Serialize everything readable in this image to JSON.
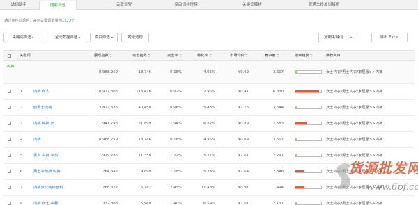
{
  "tabs": [
    {
      "label": "选词助手",
      "active": false
    },
    {
      "label": "搜索词查",
      "active": true
    },
    {
      "label": "关联词查",
      "active": false
    },
    {
      "label": "类目词排行榜",
      "active": false
    },
    {
      "label": "关键词解析",
      "active": false
    },
    {
      "label": "直通车投放词解析",
      "active": false
    }
  ],
  "hint": {
    "prefix": "通过条件过滤后，来到关键词数量为",
    "count": "1223",
    "suffix": "个"
  },
  "toolbar": {
    "keyword_filter": "关键词筛选",
    "all_data_filter": "全同数据筛选",
    "category_filter": "类目筛选",
    "region_view": "地域透视",
    "add_keyword": "复制关键词",
    "export": "导出 Excel"
  },
  "columns": [
    "关键词",
    "展现指数",
    "点击指数",
    "点击率",
    "转化率",
    "市场均价",
    "竞争度",
    "搜索趋势",
    "推荐类目"
  ],
  "first_row": {
    "label": "内裤",
    "impressions": "8,968,259",
    "clicks": "18,746",
    "ctr": "0.18%",
    "cvr": "4.95%",
    "price": "¥0.69",
    "competition": "3,617",
    "category": "女士内衣/男士内衣/家居服>>内裤",
    "trend": 0.08,
    "trend_color": "#9bcf78"
  },
  "rows": [
    {
      "num": "1",
      "keyword": "内裤 女人",
      "impressions": "10,927,306",
      "clicks": "118,426",
      "ctr": "0.92%",
      "cvr": "2.95%",
      "price": "¥0.47",
      "competition": "6,830",
      "category": "女士内衣/男士内衣/家居服>>内裤",
      "trend": 0.92,
      "trend_color": "#e05a3c"
    },
    {
      "num": "2",
      "keyword": "韵男士内裤",
      "impressions": "3,827,336",
      "clicks": "40,450",
      "ctr": "0.96%",
      "cvr": "5.48%",
      "price": "¥2.16",
      "competition": "3,644",
      "category": "女士内衣/男士内衣/家居服>>内裤",
      "trend": 0.06,
      "trend_color": "#9bcf78"
    },
    {
      "num": "3",
      "keyword": "内裤 纯棉 女",
      "impressions": "1,941,793",
      "clicks": "21,899",
      "ctr": "1.94%",
      "cvr": "6.82%",
      "price": "¥0.89",
      "competition": "2,583",
      "category": "女士内衣/男士内衣/家居服>>内裤",
      "trend": 0.42,
      "trend_color": "#e05a3c"
    },
    {
      "num": "4",
      "keyword": "内裤",
      "impressions": "8,968,259",
      "clicks": "18,746",
      "ctr": "0.18%",
      "cvr": "4.95%",
      "price": "¥0.69",
      "competition": "3,617",
      "category": "女士内衣/男士内衣/家居服>>内裤",
      "trend": 0.06,
      "trend_color": "#9bcf78"
    },
    {
      "num": "5",
      "keyword": "男人 内裤 平角",
      "impressions": "929,285",
      "clicks": "11,358",
      "ctr": "1.12%",
      "cvr": "5.77%",
      "price": "¥2.01",
      "competition": "2,291",
      "category": "女士内衣/男士内衣/家居服>>内裤",
      "trend": 0.06,
      "trend_color": "#9bcf78"
    },
    {
      "num": "6",
      "keyword": "男士平角裤 内裤",
      "impressions": "764,845",
      "clicks": "9,899",
      "ctr": "1.18%",
      "cvr": "5.78%",
      "price": "¥2.64",
      "competition": "2,848",
      "category": "女士内衣/男士内衣/家居服>>内裤",
      "trend": 0.35,
      "trend_color": "#e05a3c"
    },
    {
      "num": "7",
      "keyword": "内裤女式纯棉面料",
      "impressions": "266,822",
      "clicks": "6,782",
      "ctr": "2.45%",
      "cvr": "11.48%",
      "price": "¥0.91",
      "competition": "1,494",
      "category": "女士内衣/男士内衣/家居服>>内裤",
      "trend": 0.34,
      "trend_color": "#e05a3c"
    },
    {
      "num": "8",
      "keyword": "内裤 女士 中腰",
      "impressions": "332,303",
      "clicks": "5,969",
      "ctr": "1.40%",
      "cvr": "6.59%",
      "price": "¥1.01",
      "competition": "2,137",
      "category": "女士内衣/男士内衣/家居服>>内裤",
      "trend": 0.06,
      "trend_color": "#9bcf78"
    }
  ],
  "watermark": {
    "text": "货源批发网",
    "url": "www.6pf.com"
  }
}
